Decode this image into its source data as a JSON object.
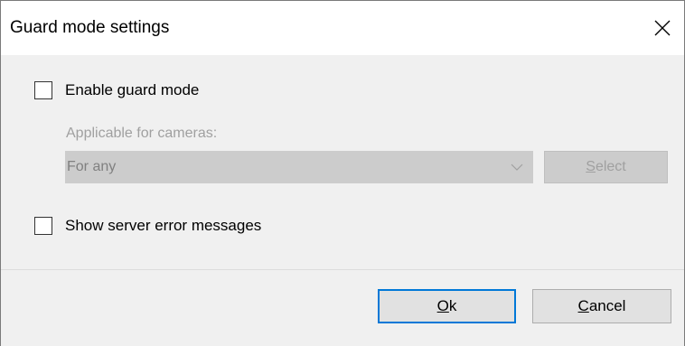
{
  "window": {
    "title": "Guard mode settings",
    "close_icon": "close-icon"
  },
  "options": {
    "enable_guard_mode": {
      "label": "Enable guard mode",
      "checked": false
    },
    "applicable_label": "Applicable for cameras:",
    "camera_select": {
      "value": "For any",
      "enabled": false
    },
    "select_button": {
      "mnemonic": "S",
      "rest": "elect",
      "enabled": false
    },
    "show_errors": {
      "label": "Show server error messages",
      "checked": false
    }
  },
  "footer": {
    "ok_button": {
      "mnemonic": "O",
      "rest": "k"
    },
    "cancel_button": {
      "mnemonic": "C",
      "rest": "ancel"
    }
  },
  "colors": {
    "accent": "#0078d7",
    "disabled_text": "#a0a0a0",
    "disabled_bg": "#cccccc",
    "dialog_bg": "#f0f0f0"
  }
}
